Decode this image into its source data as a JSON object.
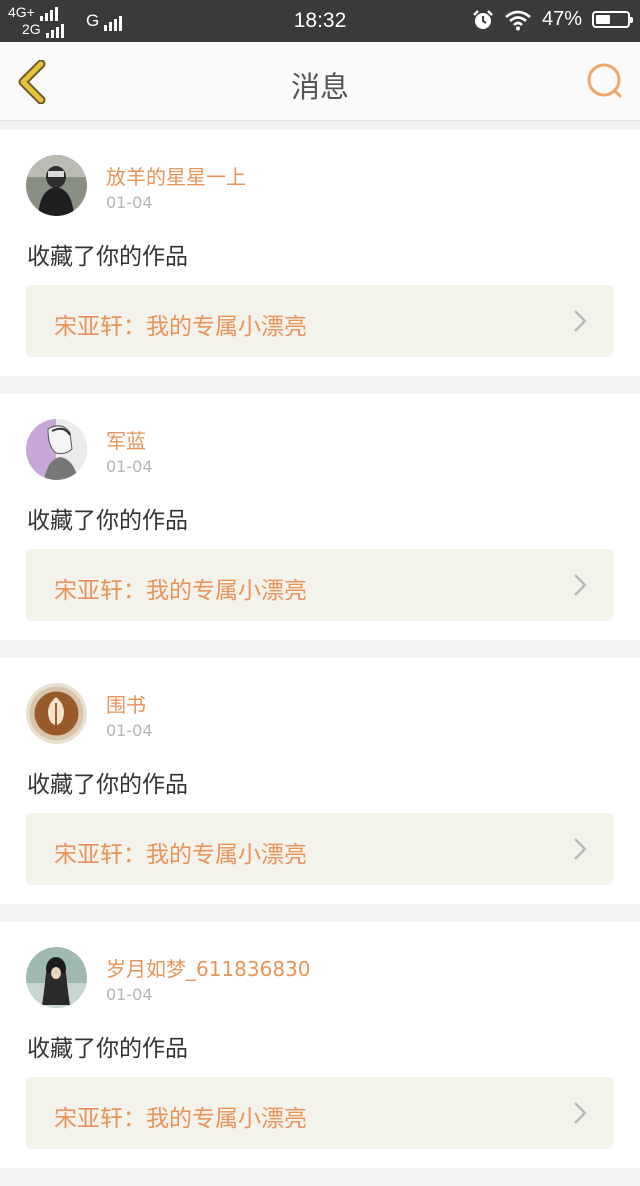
{
  "status_bar": {
    "net_line1": "4G+",
    "net_line2": "2G",
    "net_g": "G",
    "time": "18:32",
    "battery_percent": "47%",
    "battery_level": 0.47
  },
  "header": {
    "title": "消息"
  },
  "messages": [
    {
      "username": "放羊的星星一上",
      "date": "01-04",
      "action": "收藏了你的作品",
      "work_title": "宋亚轩：我的专属小漂亮"
    },
    {
      "username": "军蓝",
      "date": "01-04",
      "action": "收藏了你的作品",
      "work_title": "宋亚轩：我的专属小漂亮"
    },
    {
      "username": "围书",
      "date": "01-04",
      "action": "收藏了你的作品",
      "work_title": "宋亚轩：我的专属小漂亮"
    },
    {
      "username": "岁月如梦_611836830",
      "date": "01-04",
      "action": "收藏了你的作品",
      "work_title": "宋亚轩：我的专属小漂亮"
    }
  ],
  "colors": {
    "accent": "#e8945a",
    "back_arrow": "#e8c23a",
    "status_bar_bg": "#3a3a3a",
    "work_card_bg": "#f3f2eb"
  }
}
